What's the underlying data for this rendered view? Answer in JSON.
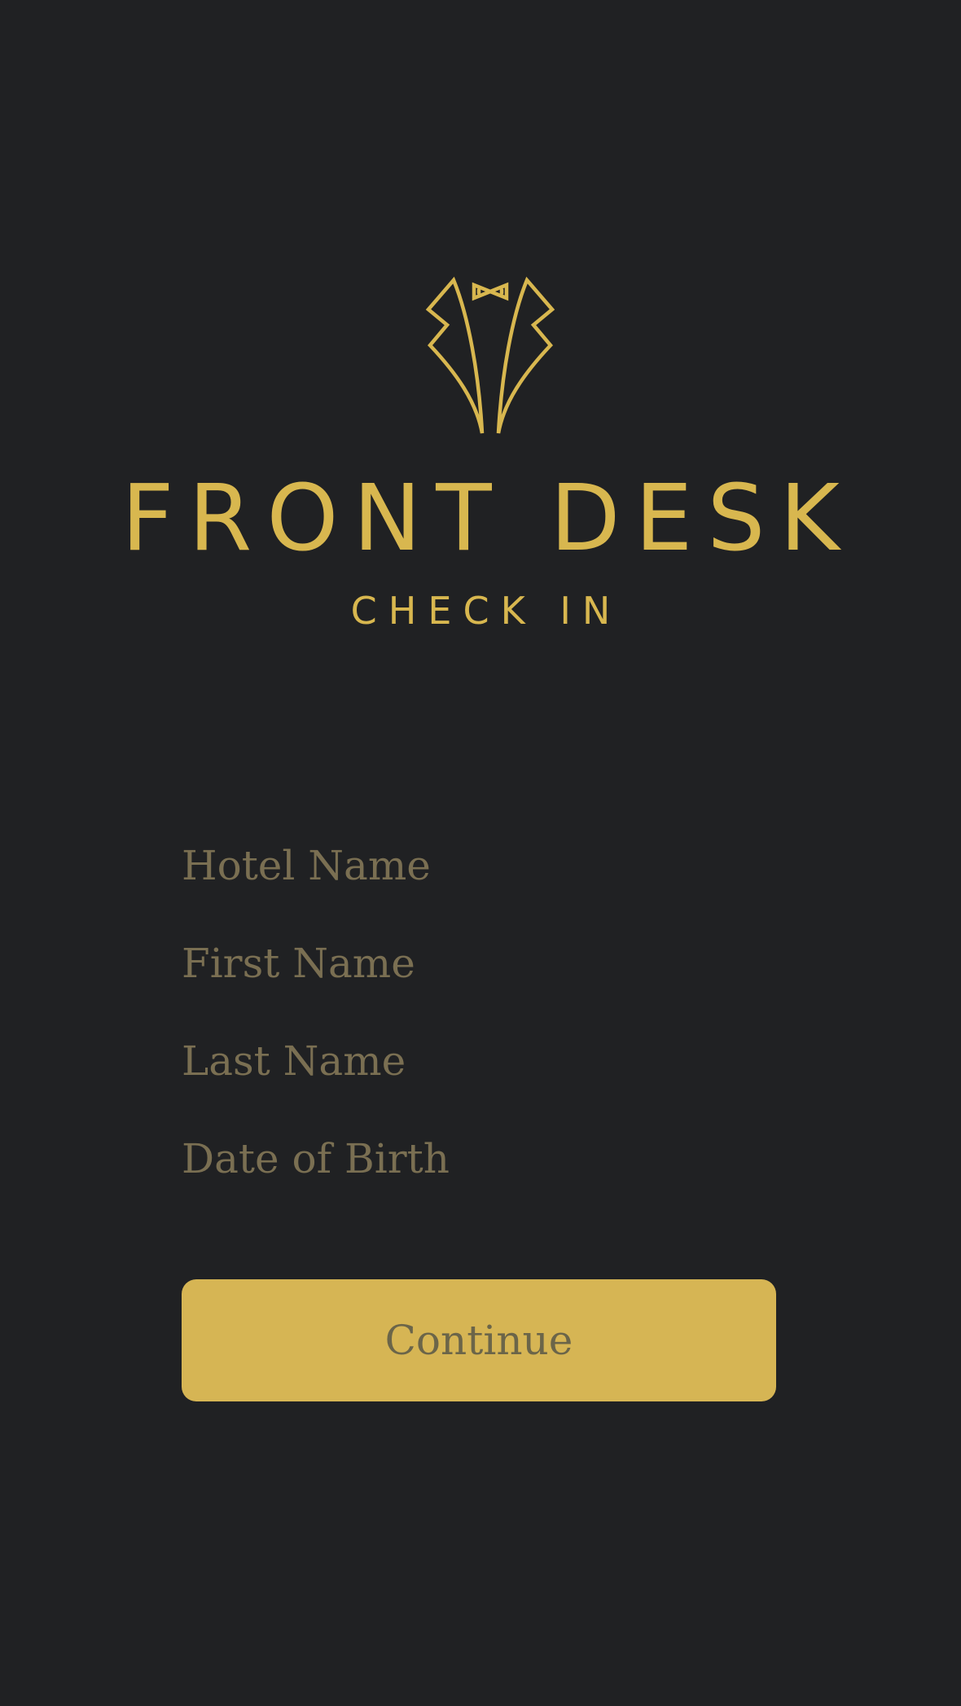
{
  "brand": {
    "title": "FRONT DESK",
    "subtitle": "CHECK IN",
    "logo_icon": "tuxedo-bowtie-icon"
  },
  "form": {
    "hotel_name_placeholder": "Hotel Name",
    "first_name_placeholder": "First Name",
    "last_name_placeholder": "Last Name",
    "dob_placeholder": "Date of Birth"
  },
  "actions": {
    "continue_label": "Continue"
  },
  "colors": {
    "background": "#202123",
    "accent_gold": "#d8b74f",
    "placeholder": "#7a6f52",
    "button_text": "#6b6549"
  }
}
